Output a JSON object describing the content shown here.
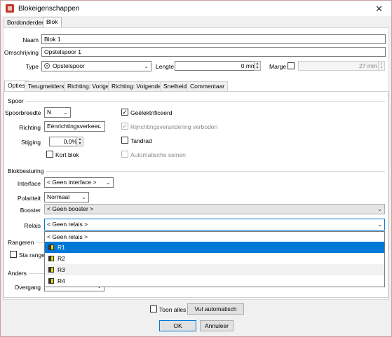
{
  "window": {
    "title": "Blokeigenschappen",
    "close": "✕"
  },
  "outer_tabs": [
    "Bordonderdeel",
    "Blok"
  ],
  "header": {
    "naam_label": "Naam",
    "naam_value": "Blok 1",
    "omschrijving_label": "Omschrijving",
    "omschrijving_value": "Opstelspoor 1",
    "type_label": "Type",
    "type_value": "Opstelspoor",
    "lengte_label": "Lengte",
    "lengte_value": "0 mm",
    "marge_label": "Marge",
    "marge_value": "27 mm"
  },
  "inner_tabs": [
    "Opties",
    "Terugmelders",
    "Richting: Vorige",
    "Richting: Volgende",
    "Snelheid",
    "Commentaar"
  ],
  "spoor": {
    "section": "Spoor",
    "spoorbreedte_label": "Spoorbreedte",
    "spoorbreedte_value": "N",
    "richting_label": "Richting",
    "richting_value": "Eénrichtingsverkeer",
    "stijging_label": "Stijging",
    "stijging_value": "0,0%",
    "kort_blok_label": "Kort blok",
    "geelektrificeerd_label": "Geëlektrificeerd",
    "rijrichting_label": "Rijrichtingsverandering verboden",
    "tandrad_label": "Tandrad",
    "automatische_label": "Automatische seinen",
    "checkmark": "✓"
  },
  "blokbesturing": {
    "section": "Blokbesturing",
    "interface_label": "Interface",
    "interface_value": "< Geen interface >",
    "polariteit_label": "Polariteit",
    "polariteit_value": "Normaal",
    "booster_label": "Booster",
    "booster_value": "< Geen booster >",
    "relais_label": "Relais",
    "relais_value": "< Geen relais >"
  },
  "relais_dropdown": {
    "options": [
      "< Geen relais >",
      "R1",
      "R2",
      "R3",
      "R4"
    ],
    "selected": "R1"
  },
  "rangeren": {
    "section": "Rangeren",
    "sta_label": "Sta ranger"
  },
  "anders": {
    "section": "Anders",
    "overgang_label": "Overgang"
  },
  "footer": {
    "toon_alles_label": "Toon alles",
    "vul_automatisch_label": "Vul automatisch",
    "ok_label": "OK",
    "annuleer_label": "Annuleer"
  },
  "arrows": {
    "down": "⌄",
    "spin_up": "▲",
    "spin_down": "▼"
  }
}
